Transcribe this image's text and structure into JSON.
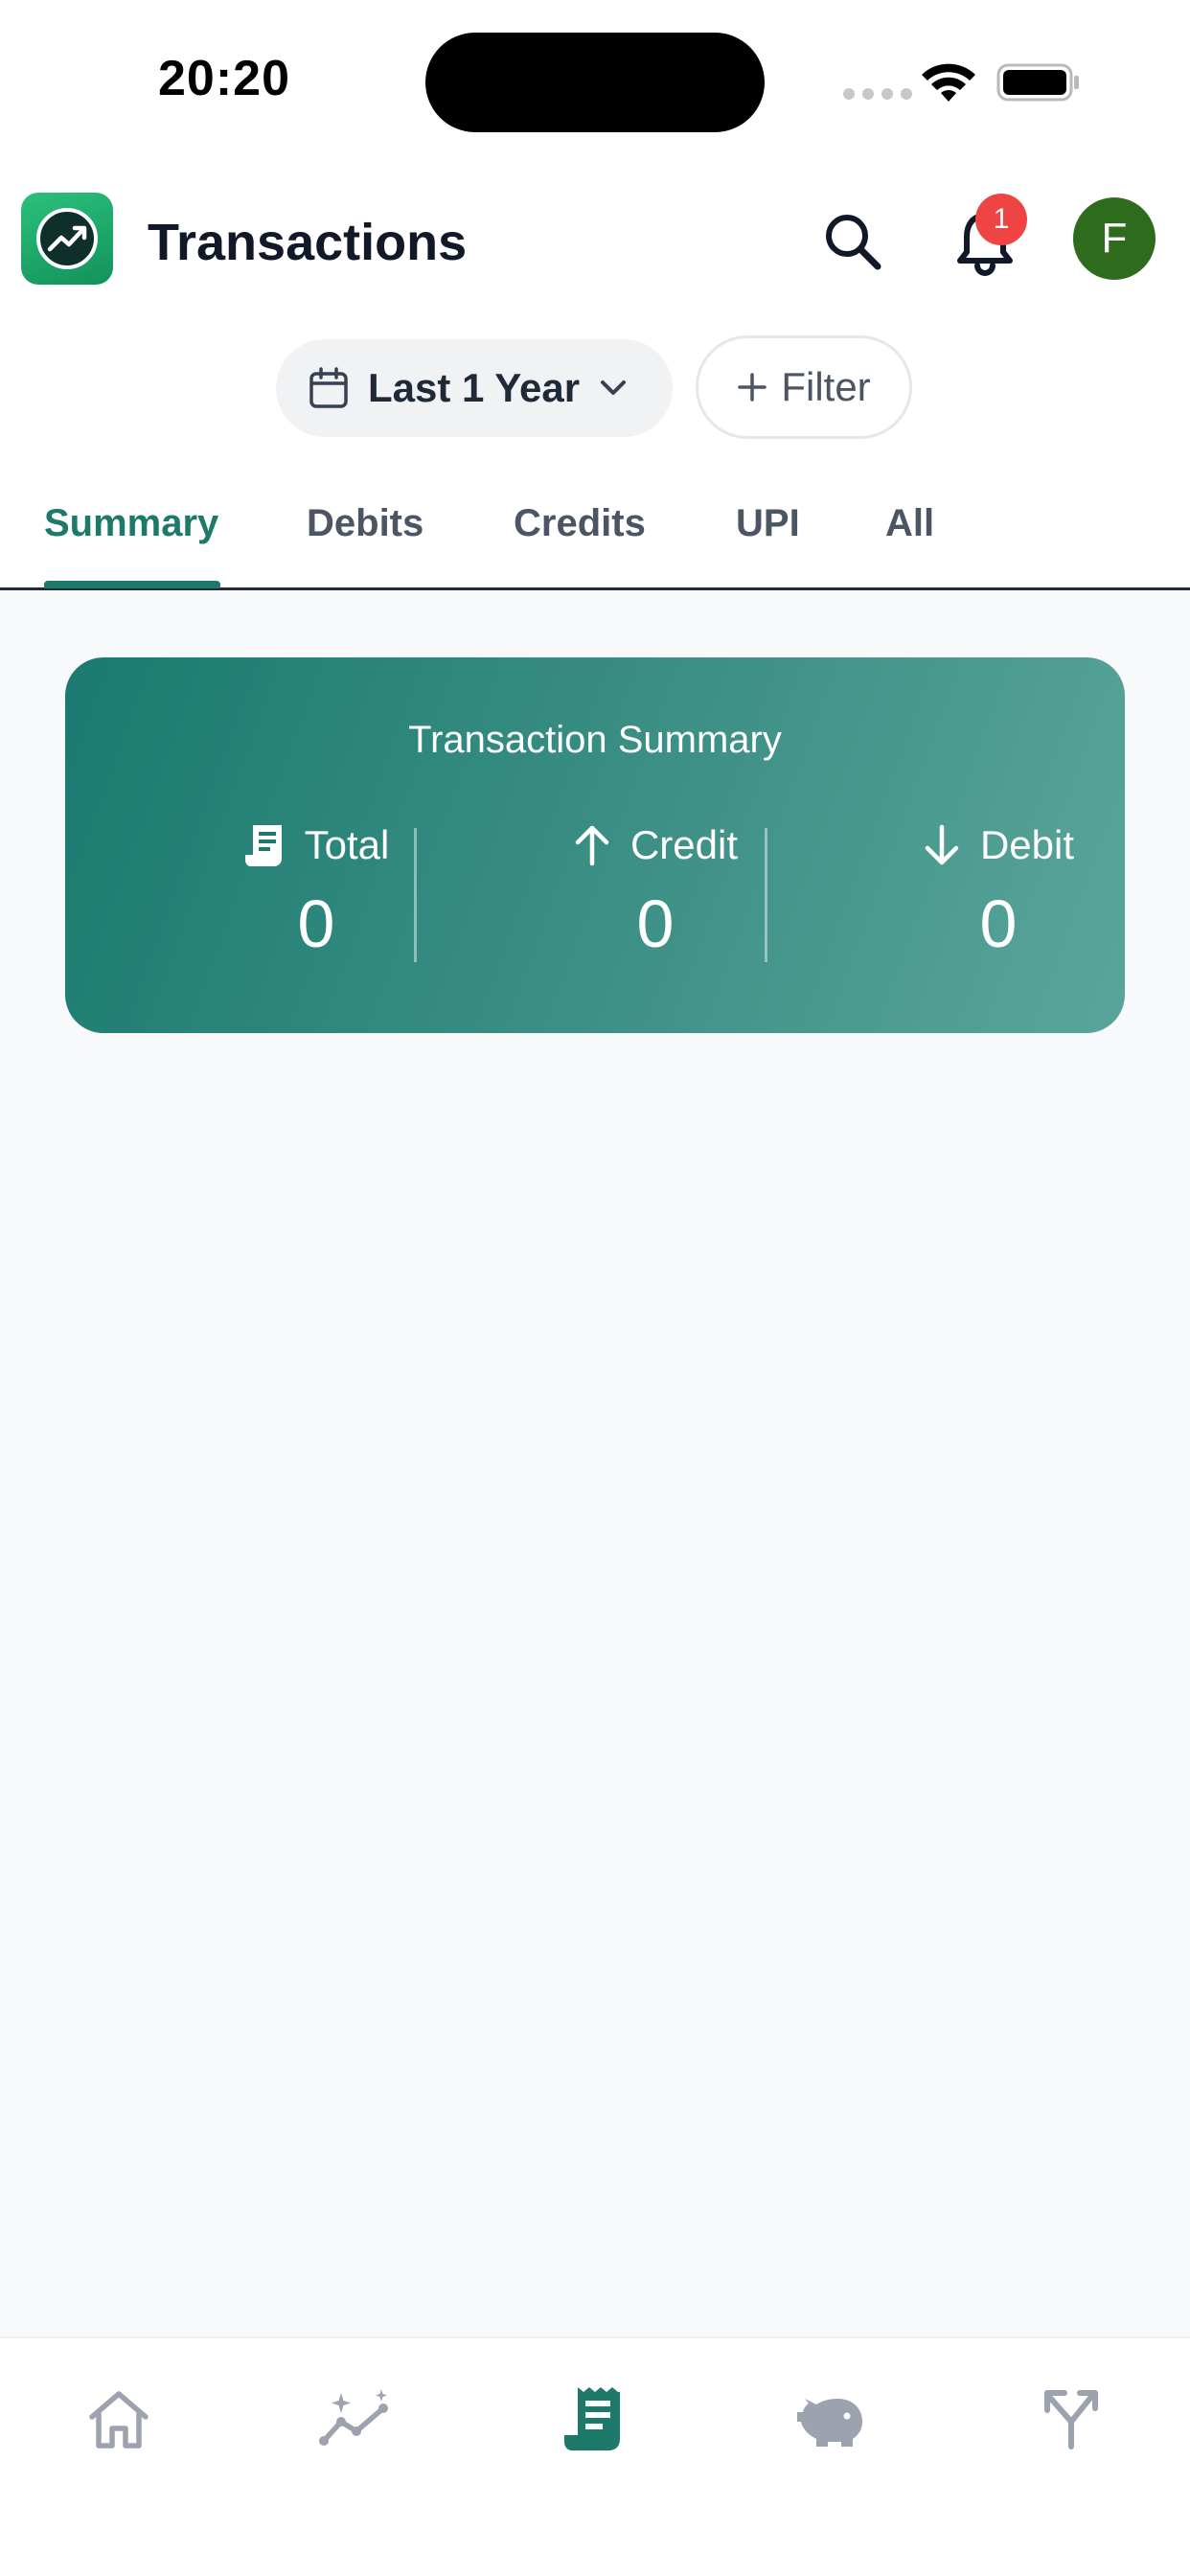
{
  "status_bar": {
    "time": "20:20"
  },
  "header": {
    "title": "Transactions",
    "notification_count": "1",
    "avatar_initial": "F"
  },
  "filters": {
    "period_label": "Last 1 Year",
    "filter_label": "Filter"
  },
  "tabs": [
    {
      "label": "Summary",
      "active": true
    },
    {
      "label": "Debits",
      "active": false
    },
    {
      "label": "Credits",
      "active": false
    },
    {
      "label": "UPI",
      "active": false
    },
    {
      "label": "All",
      "active": false
    }
  ],
  "summary": {
    "title": "Transaction Summary",
    "total": {
      "label": "Total",
      "value": "0",
      "icon": "receipt-icon"
    },
    "credit": {
      "label": "Credit",
      "value": "0",
      "icon": "arrow-up-icon"
    },
    "debit": {
      "label": "Debit",
      "value": "0",
      "icon": "arrow-down-icon"
    }
  },
  "bottom_nav": [
    {
      "icon": "home-icon",
      "active": false
    },
    {
      "icon": "analytics-icon",
      "active": false
    },
    {
      "icon": "transactions-icon",
      "active": true
    },
    {
      "icon": "piggy-bank-icon",
      "active": false
    },
    {
      "icon": "split-icon",
      "active": false
    }
  ],
  "colors": {
    "accent": "#1d7a6b",
    "badge": "#ef4444",
    "avatar": "#2f6b1c",
    "inactive_icon": "#9ca3af"
  }
}
